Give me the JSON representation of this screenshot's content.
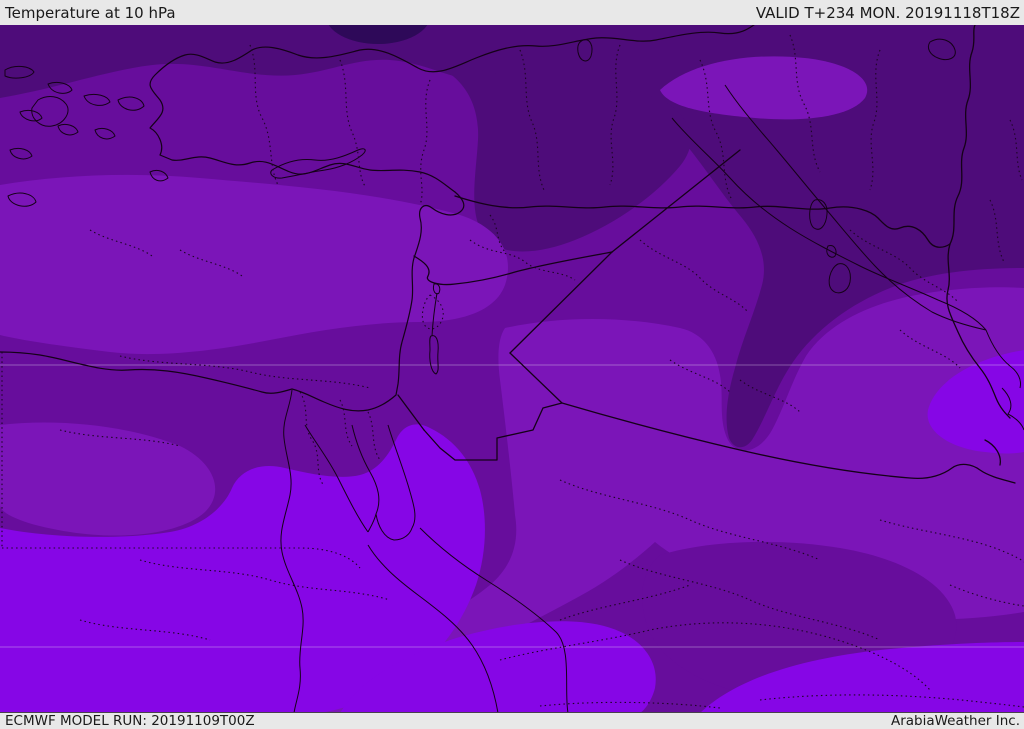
{
  "header": {
    "title": "Temperature at 10 hPa",
    "valid_label": "VALID T+234 MON. 20191118T18Z"
  },
  "footer": {
    "model_run_label": "ECMWF MODEL RUN: 20191109T00Z",
    "attribution": "ArabiaWeather Inc."
  },
  "map": {
    "parameter": "Temperature",
    "level": "10 hPa",
    "model": "ECMWF",
    "region_shown": "Middle East / Eastern Mediterranean",
    "colors": {
      "band_darkest": "#2e0959",
      "band_dark": "#4e0c7a",
      "band_medium": "#670d9c",
      "band_light": "#7b15b8",
      "band_bright": "#8606e6",
      "line": "#150118",
      "graticule": "#e6d7f0",
      "bar_bg": "#e8e8e8",
      "bar_text": "#1a1a1a"
    }
  }
}
